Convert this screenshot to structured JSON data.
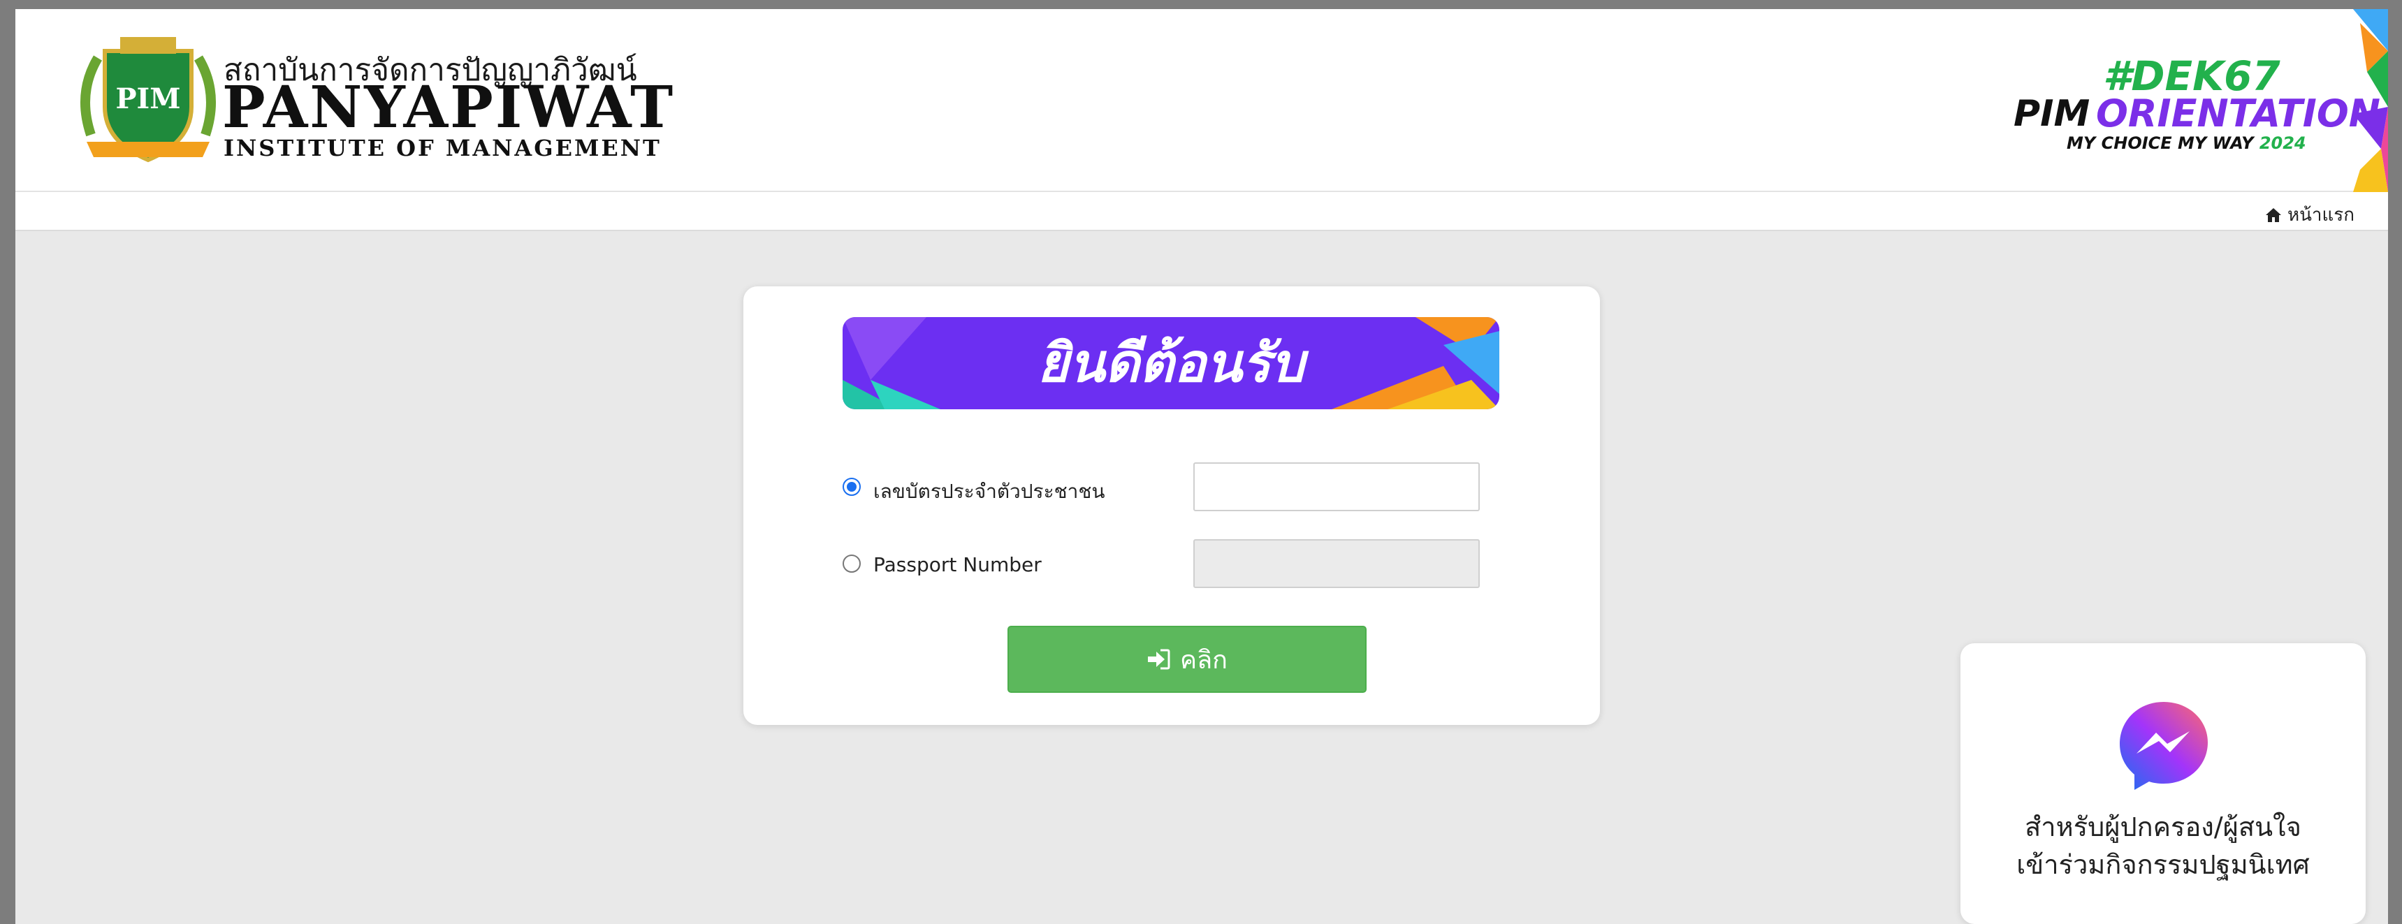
{
  "header": {
    "logo_crest": "PIM",
    "brand_thai": "สถาบันการจัดการปัญญาภิวัฒน์",
    "brand_name": "PANYAPIWAT",
    "brand_sub": "INSTITUTE OF MANAGEMENT",
    "event_hashtag": "#DEK67",
    "event_pim": "PIM",
    "event_orientation": "ORIENTATION",
    "event_tagline": "MY CHOICE MY WAY",
    "event_year": "2024"
  },
  "breadcrumb": {
    "icon": "home-icon",
    "label": "หน้าแรก"
  },
  "login": {
    "banner": "ยินดีต้อนรับ",
    "option_id_label": "เลขบัตรประจำตัวประชาชน",
    "option_id_selected": true,
    "id_value": "",
    "option_passport_label": "Passport Number",
    "passport_value": "",
    "submit_label": "คลิก",
    "submit_icon": "sign-in-icon"
  },
  "messenger": {
    "icon": "messenger-icon",
    "line1": "สำหรับผู้ปกครอง/ผู้สนใจ",
    "line2": "เข้าร่วมกิจกรรมปฐมนิเทศ"
  },
  "colors": {
    "accent_green": "#5cb85c",
    "banner_purple": "#6c2ff2",
    "brand_green": "#1f8a3c",
    "orientation_purple": "#7b2fe8"
  }
}
